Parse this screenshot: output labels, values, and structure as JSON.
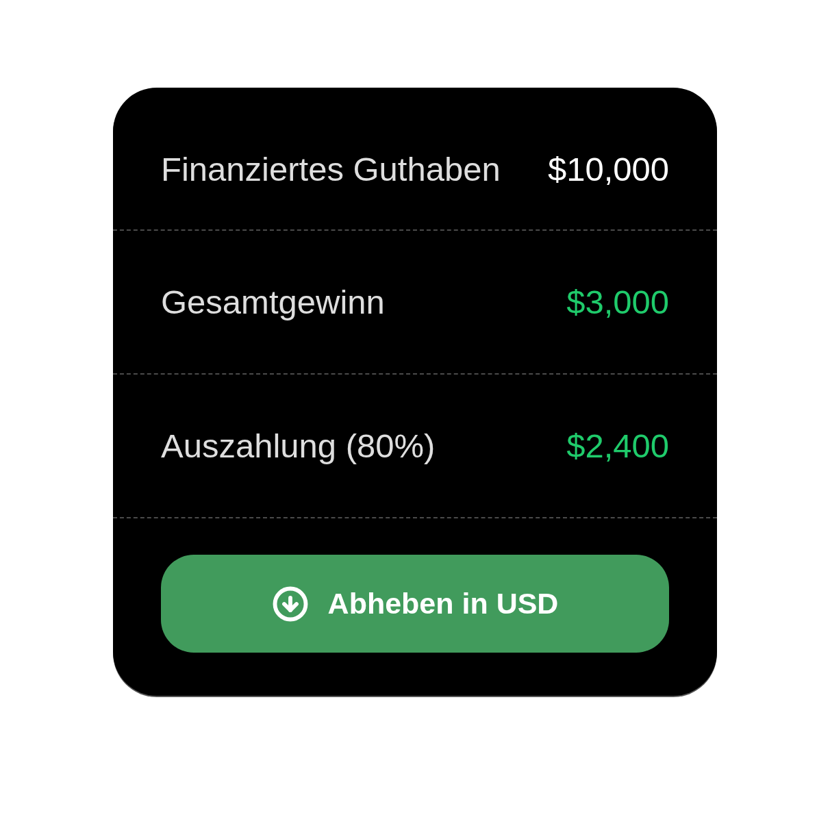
{
  "rows": [
    {
      "label": "Finanziertes Guthaben",
      "value": "$10,000",
      "color": "#ffffff"
    },
    {
      "label": "Gesamtgewinn",
      "value": "$3,000",
      "color": "#1fcb6b"
    },
    {
      "label": "Auszahlung (80%)",
      "value": "$2,400",
      "color": "#1fcb6b"
    }
  ],
  "button": {
    "label": "Abheben in USD"
  }
}
